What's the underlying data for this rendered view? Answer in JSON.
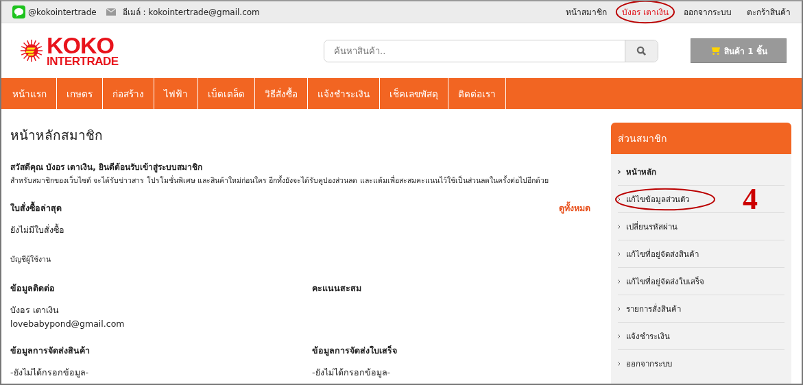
{
  "top_bar": {
    "line_id": "@kokointertrade",
    "email": "อีเมล์ : kokointertrade@gmail.com",
    "links": [
      {
        "label": "หน้าสมาชิก",
        "kind": "plain",
        "circled": false
      },
      {
        "label": "บังอร เตาเงิน",
        "kind": "user",
        "circled": true
      },
      {
        "label": "ออกจากระบบ",
        "kind": "plain",
        "circled": false
      },
      {
        "label": "ตะกร้าสินค้า",
        "kind": "plain",
        "circled": false
      }
    ]
  },
  "logo": {
    "line_1": "KOKO",
    "line_2": "INTERTRADE"
  },
  "search": {
    "placeholder": "ค้นหาสินค้า.."
  },
  "cart": {
    "label": "สินค้า 1 ชิ้น"
  },
  "nav": [
    "หน้าแรก",
    "เกษตร",
    "ก่อสร้าง",
    "ไฟฟ้า",
    "เบ็ดเตล็ด",
    "วิธีสั่งซื้อ",
    "แจ้งชำระเงิน",
    "เช็คเลขพัสดุ",
    "ติดต่อเรา"
  ],
  "main": {
    "title": "หน้าหลักสมาชิก",
    "greeting": "สวัสดีคุณ  บังอร เตาเงิน, ยินดีต้อนรับเข้าสู่ระบบสมาชิก",
    "intro": "สำหรับสมาชิกของเว็บไซต์ จะได้รับข่าวสาร โปรโมชั่นพิเศษ และสินค้าใหม่ก่อนใคร อีกทั้งยังจะได้รับคูปองส่วนลด และแต้มเพื่อสะสมคะแนนไว้ใช้เป็นส่วนลดในครั้งต่อไปอีกด้วย",
    "orders_heading": "ใบสั่งซื้อล่าสุด",
    "view_all": "ดูทั้งหมด",
    "orders_empty": "ยังไม่มีใบสั่งซื้อ",
    "account_label": "บัญชีผู้ใช้งาน",
    "sections": [
      {
        "heading": "ข้อมูลติดต่อ",
        "lines": [
          "บังอร เตาเงิน",
          "lovebabypond@gmail.com"
        ]
      },
      {
        "heading": "คะแนนสะสม"
      },
      {
        "heading": "ข้อมูลการจัดส่งสินค้า",
        "lines": [
          "-ยังไม่ได้กรอกข้อมูล-"
        ]
      },
      {
        "heading": "ข้อมูลการจัดส่งใบเสร็จ",
        "lines": [
          "-ยังไม่ได้กรอกข้อมูล-"
        ]
      }
    ]
  },
  "sidebar": {
    "title": "ส่วนสมาชิก",
    "items": [
      {
        "label": "หน้าหลัก",
        "selected": true,
        "circled": false
      },
      {
        "label": "แก้ไขข้อมูลส่วนตัว",
        "selected": false,
        "circled": true
      },
      {
        "label": "เปลี่ยนรหัสผ่าน",
        "selected": false,
        "circled": false
      },
      {
        "label": "แก้ไขที่อยู่จัดส่งสินค้า",
        "selected": false,
        "circled": false
      },
      {
        "label": "แก้ไขที่อยู่จัดส่งใบเสร็จ",
        "selected": false,
        "circled": false
      },
      {
        "label": "รายการสั่งสินค้า",
        "selected": false,
        "circled": false
      },
      {
        "label": "แจ้งชำระเงิน",
        "selected": false,
        "circled": false
      },
      {
        "label": "ออกจากระบบ",
        "selected": false,
        "circled": false
      }
    ]
  },
  "annotation": {
    "step": "4"
  }
}
